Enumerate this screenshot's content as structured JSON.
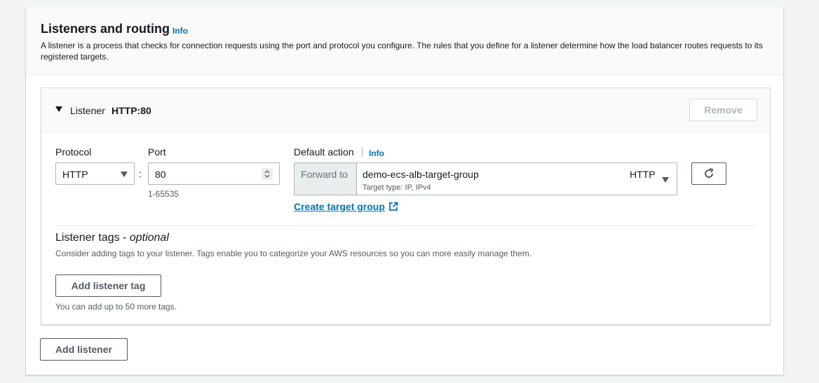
{
  "section": {
    "title": "Listeners and routing",
    "info": "Info",
    "description": "A listener is a process that checks for connection requests using the port and protocol you configure. The rules that you define for a listener determine how the load balancer routes requests to its registered targets."
  },
  "listener": {
    "label": "Listener",
    "name": "HTTP:80",
    "remove_label": "Remove",
    "protocol": {
      "label": "Protocol",
      "value": "HTTP"
    },
    "separator": ":",
    "port": {
      "label": "Port",
      "value": "80",
      "hint": "1-65535"
    },
    "default_action": {
      "label": "Default action",
      "info": "Info",
      "forward_label": "Forward to",
      "target_group": "demo-ecs-alb-target-group",
      "target_type": "Target type: IP, IPv4",
      "protocol": "HTTP",
      "create_link": "Create target group"
    },
    "tags": {
      "title": "Listener tags",
      "optional": "optional",
      "dash": " - ",
      "description": "Consider adding tags to your listener. Tags enable you to categorize your AWS resources so you can more easily manage them.",
      "add_label": "Add listener tag",
      "limit_hint": "You can add up to 50 more tags."
    }
  },
  "add_listener_label": "Add listener",
  "icons": {
    "refresh": "refresh-icon",
    "external_link": "external-link-icon",
    "caret_down": "caret-down-icon"
  },
  "colors": {
    "link": "#0073bb",
    "text": "#16191f",
    "muted": "#545b64",
    "border": "#aab7b8",
    "background": "#f2f3f3"
  }
}
